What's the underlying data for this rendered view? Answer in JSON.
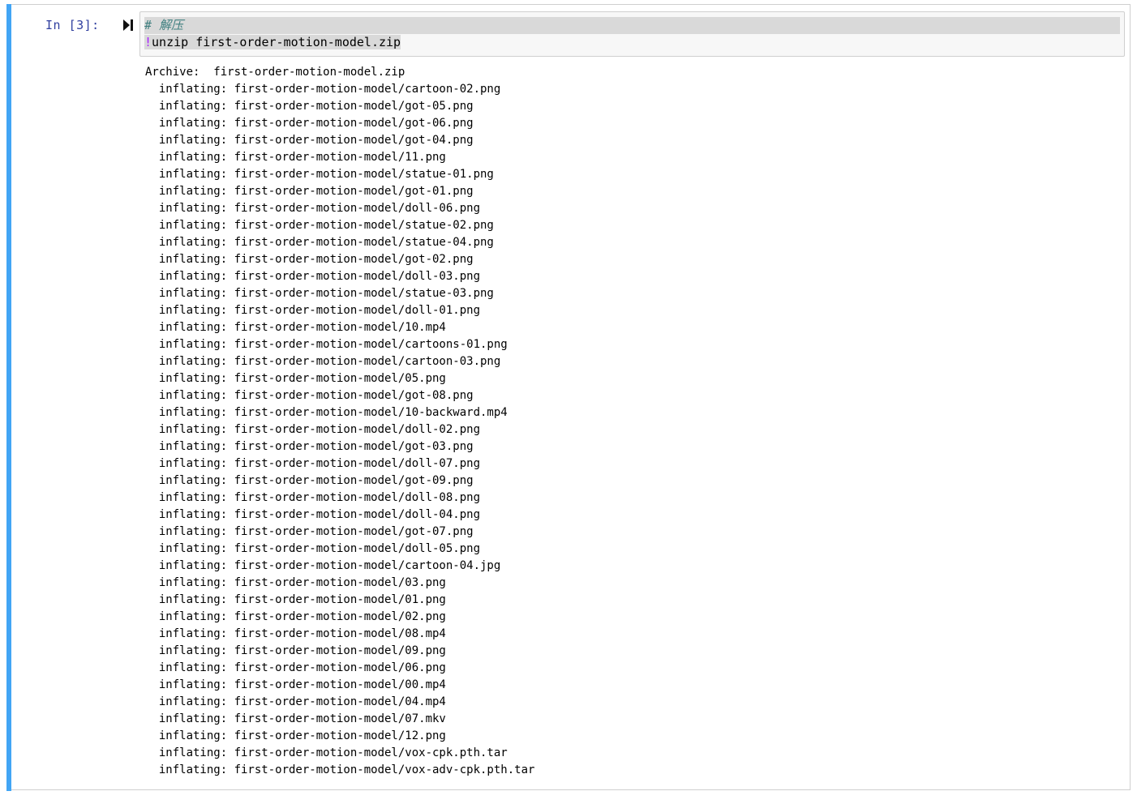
{
  "cell": {
    "prompt": "In  [3]:",
    "run_icon": "run-cell-icon",
    "accent_color": "#42a5f5",
    "code": {
      "line1": "# 解压",
      "line2_bang": "!",
      "line2_cmd": "unzip first-order-motion-model.zip"
    }
  },
  "output": {
    "lines": [
      "Archive:  first-order-motion-model.zip",
      "  inflating: first-order-motion-model/cartoon-02.png",
      "  inflating: first-order-motion-model/got-05.png",
      "  inflating: first-order-motion-model/got-06.png",
      "  inflating: first-order-motion-model/got-04.png",
      "  inflating: first-order-motion-model/11.png",
      "  inflating: first-order-motion-model/statue-01.png",
      "  inflating: first-order-motion-model/got-01.png",
      "  inflating: first-order-motion-model/doll-06.png",
      "  inflating: first-order-motion-model/statue-02.png",
      "  inflating: first-order-motion-model/statue-04.png",
      "  inflating: first-order-motion-model/got-02.png",
      "  inflating: first-order-motion-model/doll-03.png",
      "  inflating: first-order-motion-model/statue-03.png",
      "  inflating: first-order-motion-model/doll-01.png",
      "  inflating: first-order-motion-model/10.mp4",
      "  inflating: first-order-motion-model/cartoons-01.png",
      "  inflating: first-order-motion-model/cartoon-03.png",
      "  inflating: first-order-motion-model/05.png",
      "  inflating: first-order-motion-model/got-08.png",
      "  inflating: first-order-motion-model/10-backward.mp4",
      "  inflating: first-order-motion-model/doll-02.png",
      "  inflating: first-order-motion-model/got-03.png",
      "  inflating: first-order-motion-model/doll-07.png",
      "  inflating: first-order-motion-model/got-09.png",
      "  inflating: first-order-motion-model/doll-08.png",
      "  inflating: first-order-motion-model/doll-04.png",
      "  inflating: first-order-motion-model/got-07.png",
      "  inflating: first-order-motion-model/doll-05.png",
      "  inflating: first-order-motion-model/cartoon-04.jpg",
      "  inflating: first-order-motion-model/03.png",
      "  inflating: first-order-motion-model/01.png",
      "  inflating: first-order-motion-model/02.png",
      "  inflating: first-order-motion-model/08.mp4",
      "  inflating: first-order-motion-model/09.png",
      "  inflating: first-order-motion-model/06.png",
      "  inflating: first-order-motion-model/00.mp4",
      "  inflating: first-order-motion-model/04.mp4",
      "  inflating: first-order-motion-model/07.mkv",
      "  inflating: first-order-motion-model/12.png",
      "  inflating: first-order-motion-model/vox-cpk.pth.tar",
      "  inflating: first-order-motion-model/vox-adv-cpk.pth.tar"
    ]
  }
}
